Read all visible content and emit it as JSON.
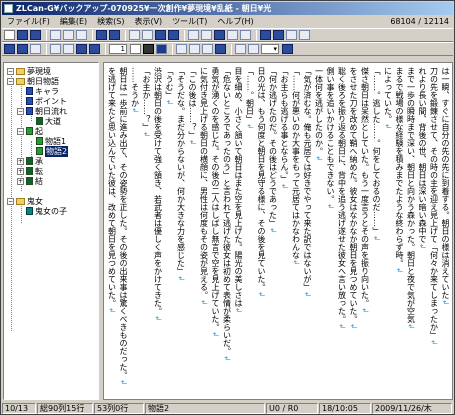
{
  "window": {
    "title": "ZLCan-G¥バックアップ-070925¥ー次創作¥夢現境¥乱紙 - 朝日¥光"
  },
  "menu": [
    {
      "key": "file",
      "label": "ファイル(F)"
    },
    {
      "key": "edit",
      "label": "編集(E)"
    },
    {
      "key": "search",
      "label": "検索(S)"
    },
    {
      "key": "view",
      "label": "表示(V)"
    },
    {
      "key": "tools",
      "label": "ツール(T)"
    },
    {
      "key": "help",
      "label": "ヘルプ(H)"
    }
  ],
  "counter": "68104 / 12114",
  "toolbar3": {
    "dropdown1": "1",
    "dropdown2": "▾"
  },
  "tree": {
    "items": [
      {
        "label": "夢現境",
        "level": 0,
        "icon": "folder-icon",
        "expanded": true
      },
      {
        "label": "朝日物語",
        "level": 0,
        "icon": "folder-icon",
        "expanded": true
      },
      {
        "label": "キャラ",
        "level": 1,
        "icon": "doc-icon",
        "color": "blue"
      },
      {
        "label": "ポイント",
        "level": 1,
        "icon": "doc-icon",
        "color": "blue"
      },
      {
        "label": "朝日流れ",
        "level": 1,
        "icon": "doc-icon",
        "color": "blue"
      },
      {
        "label": "大道",
        "level": 2,
        "icon": "doc-icon",
        "color": "dkgreen"
      },
      {
        "label": "起",
        "level": 1,
        "icon": "doc-icon",
        "color": "green",
        "expanded": true
      },
      {
        "label": "物語1",
        "level": 2,
        "icon": "doc-icon",
        "color": "green"
      },
      {
        "label": "物語2",
        "level": 2,
        "icon": "doc-icon",
        "color": "green",
        "selected": true
      },
      {
        "label": "承",
        "level": 1,
        "icon": "doc-icon",
        "color": "dkgreen"
      },
      {
        "label": "転",
        "level": 1,
        "icon": "doc-icon",
        "color": "dkgreen"
      },
      {
        "label": "結",
        "level": 1,
        "icon": "doc-icon",
        "color": "dkgreen"
      },
      {
        "label": "鬼女",
        "level": 0,
        "icon": "folder-icon",
        "expanded": true
      },
      {
        "label": "鬼女の子",
        "level": 1,
        "icon": "doc-icon",
        "color": "teal"
      }
    ]
  },
  "editor": {
    "columns": [
      "は一瞬、すぐに自分の先の先に到着する。朝日の様は消えていた",
      "刀の先を鍛錬させて、その時の主を迎え見上げて「何々か来てしまったか」",
      "れより長い間、背後の世、朝日は深い暗い森中で",
      "まで一歩の瞬時まで深い、朝日と向かう森かった。朝日と夜で気が空気",
      "まるで戦場の様な経験を積みまでたような終わらず時。",
      "によっていた。",
      "「……。逃した……。何をしておるのだ……」",
      "傑さ朝日は呆然としていた。もう一度言うとその声を振り向いた。",
      "をさせた刀を改めて鞘へ納めた。彼女はなかなか朝日を見つめていた。",
      "聡く後ろを振り返る朝日に、背中を追う逃げ遂せた彼女へ言い放った。",
      "側い事を追いかけることもできない。",
      "一体何を逃がしたのか。",
      "「気が済むな。俺も元居ては好きでやって来た訳ではないが」",
      "「……何が悪いのか大事をもって元居てはかなわんな",
      "「お主らも逃げる事とならん。」",
      "「何か逃げたのだ。その後はどうであった」",
      "日の光は、もう何度と朝日を見守る様に、その後を見ていた。",
      "「……。朝日」",
      "目を細め、小さく頷いて朝日はまた空を見上げた。陽光の美しさは",
      "「危ないところであったのう」と言われて逃げた彼女は初めて表情が柔らいだ。",
      "勇気が湧くのを感じた。その後の二人はしばし無言で空を見上げていた。",
      "に気付き見上げる朝日の横顔に、男性は何度もその姿が見える。",
      "「この後は……？」",
      "「そうだな。まだ分からないが、何か大きな力を感じた」",
      "「うむ」",
      "渋沢は朝日の後を受けて強く頷き、若武者は優しく声をかけてきた。",
      "「お主か……？」",
      "……そうか",
      "朝日は一歩前に進み出て、その姿勢を正した。その後の出来事は驚くべきものだった。",
      "を逃げて来たと思い込んでいた彼は、改めて朝日を見つめていた。"
    ],
    "mark": "↲"
  },
  "status": {
    "position": "10/13",
    "total": "総90列15行",
    "chars": "53列0行",
    "doc": "物語2",
    "mode": "U0 / R0",
    "size": "18/10:05",
    "date": "2009/11/26/木"
  }
}
